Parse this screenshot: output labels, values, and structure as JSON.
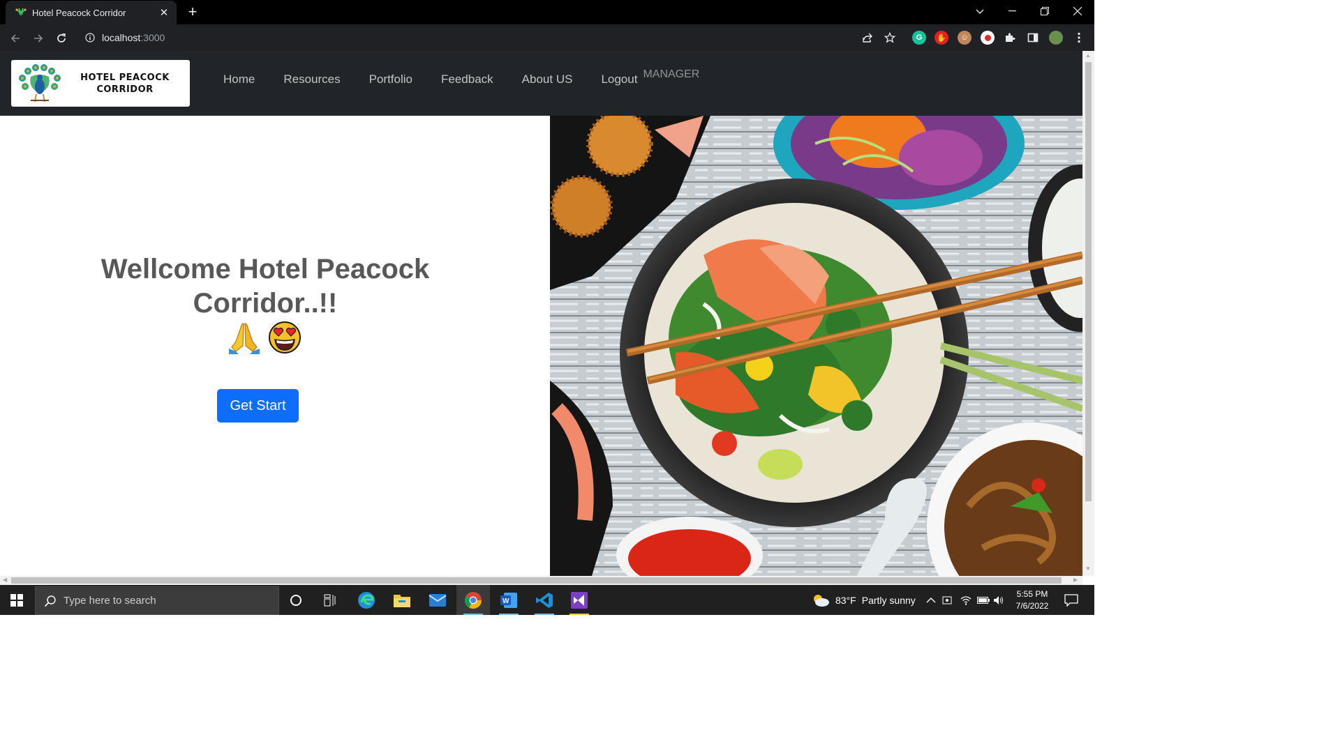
{
  "browser": {
    "tab_title": "Hotel Peacock Corridor",
    "url_host": "localhost",
    "url_port": ":3000"
  },
  "site": {
    "brand_line1": "HOTEL PEACOCK",
    "brand_line2": "CORRIDOR",
    "nav": [
      "Home",
      "Resources",
      "Portfolio",
      "Feedback",
      "About US",
      "Logout"
    ],
    "role_label": "MANAGER"
  },
  "hero": {
    "title": "Wellcome Hotel Peacock Corridor..!!",
    "button_label": "Get Start",
    "emojis": [
      "folded-hands",
      "smiling-face-with-heart-eyes"
    ]
  },
  "taskbar": {
    "search_placeholder": "Type here to search",
    "weather_temp": "83°F",
    "weather_text": "Partly sunny",
    "time": "5:55 PM",
    "date": "7/6/2022"
  },
  "colors": {
    "nav_bg": "#212529",
    "primary": "#0d6efd",
    "title_text": "#585858"
  }
}
